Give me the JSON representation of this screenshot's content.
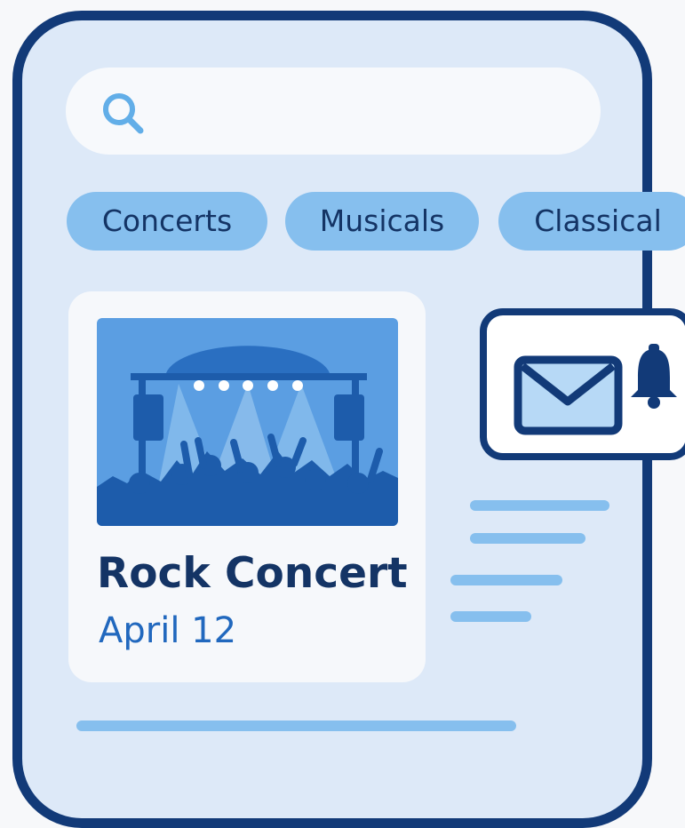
{
  "search": {
    "placeholder": ""
  },
  "categories": [
    {
      "label": "Concerts"
    },
    {
      "label": "Musicals"
    },
    {
      "label": "Classical"
    }
  ],
  "event": {
    "title": "Rock Concert",
    "date": "April 12"
  },
  "icons": {
    "search": "search-icon",
    "image": "concert-stage-image",
    "mail": "envelope-icon",
    "bell": "bell-icon"
  },
  "colors": {
    "frame": "#123a78",
    "screen_bg": "#dde9f8",
    "chip_bg": "#86bfee",
    "chip_text": "#143465",
    "title_text": "#143465",
    "date_text": "#2168be"
  }
}
